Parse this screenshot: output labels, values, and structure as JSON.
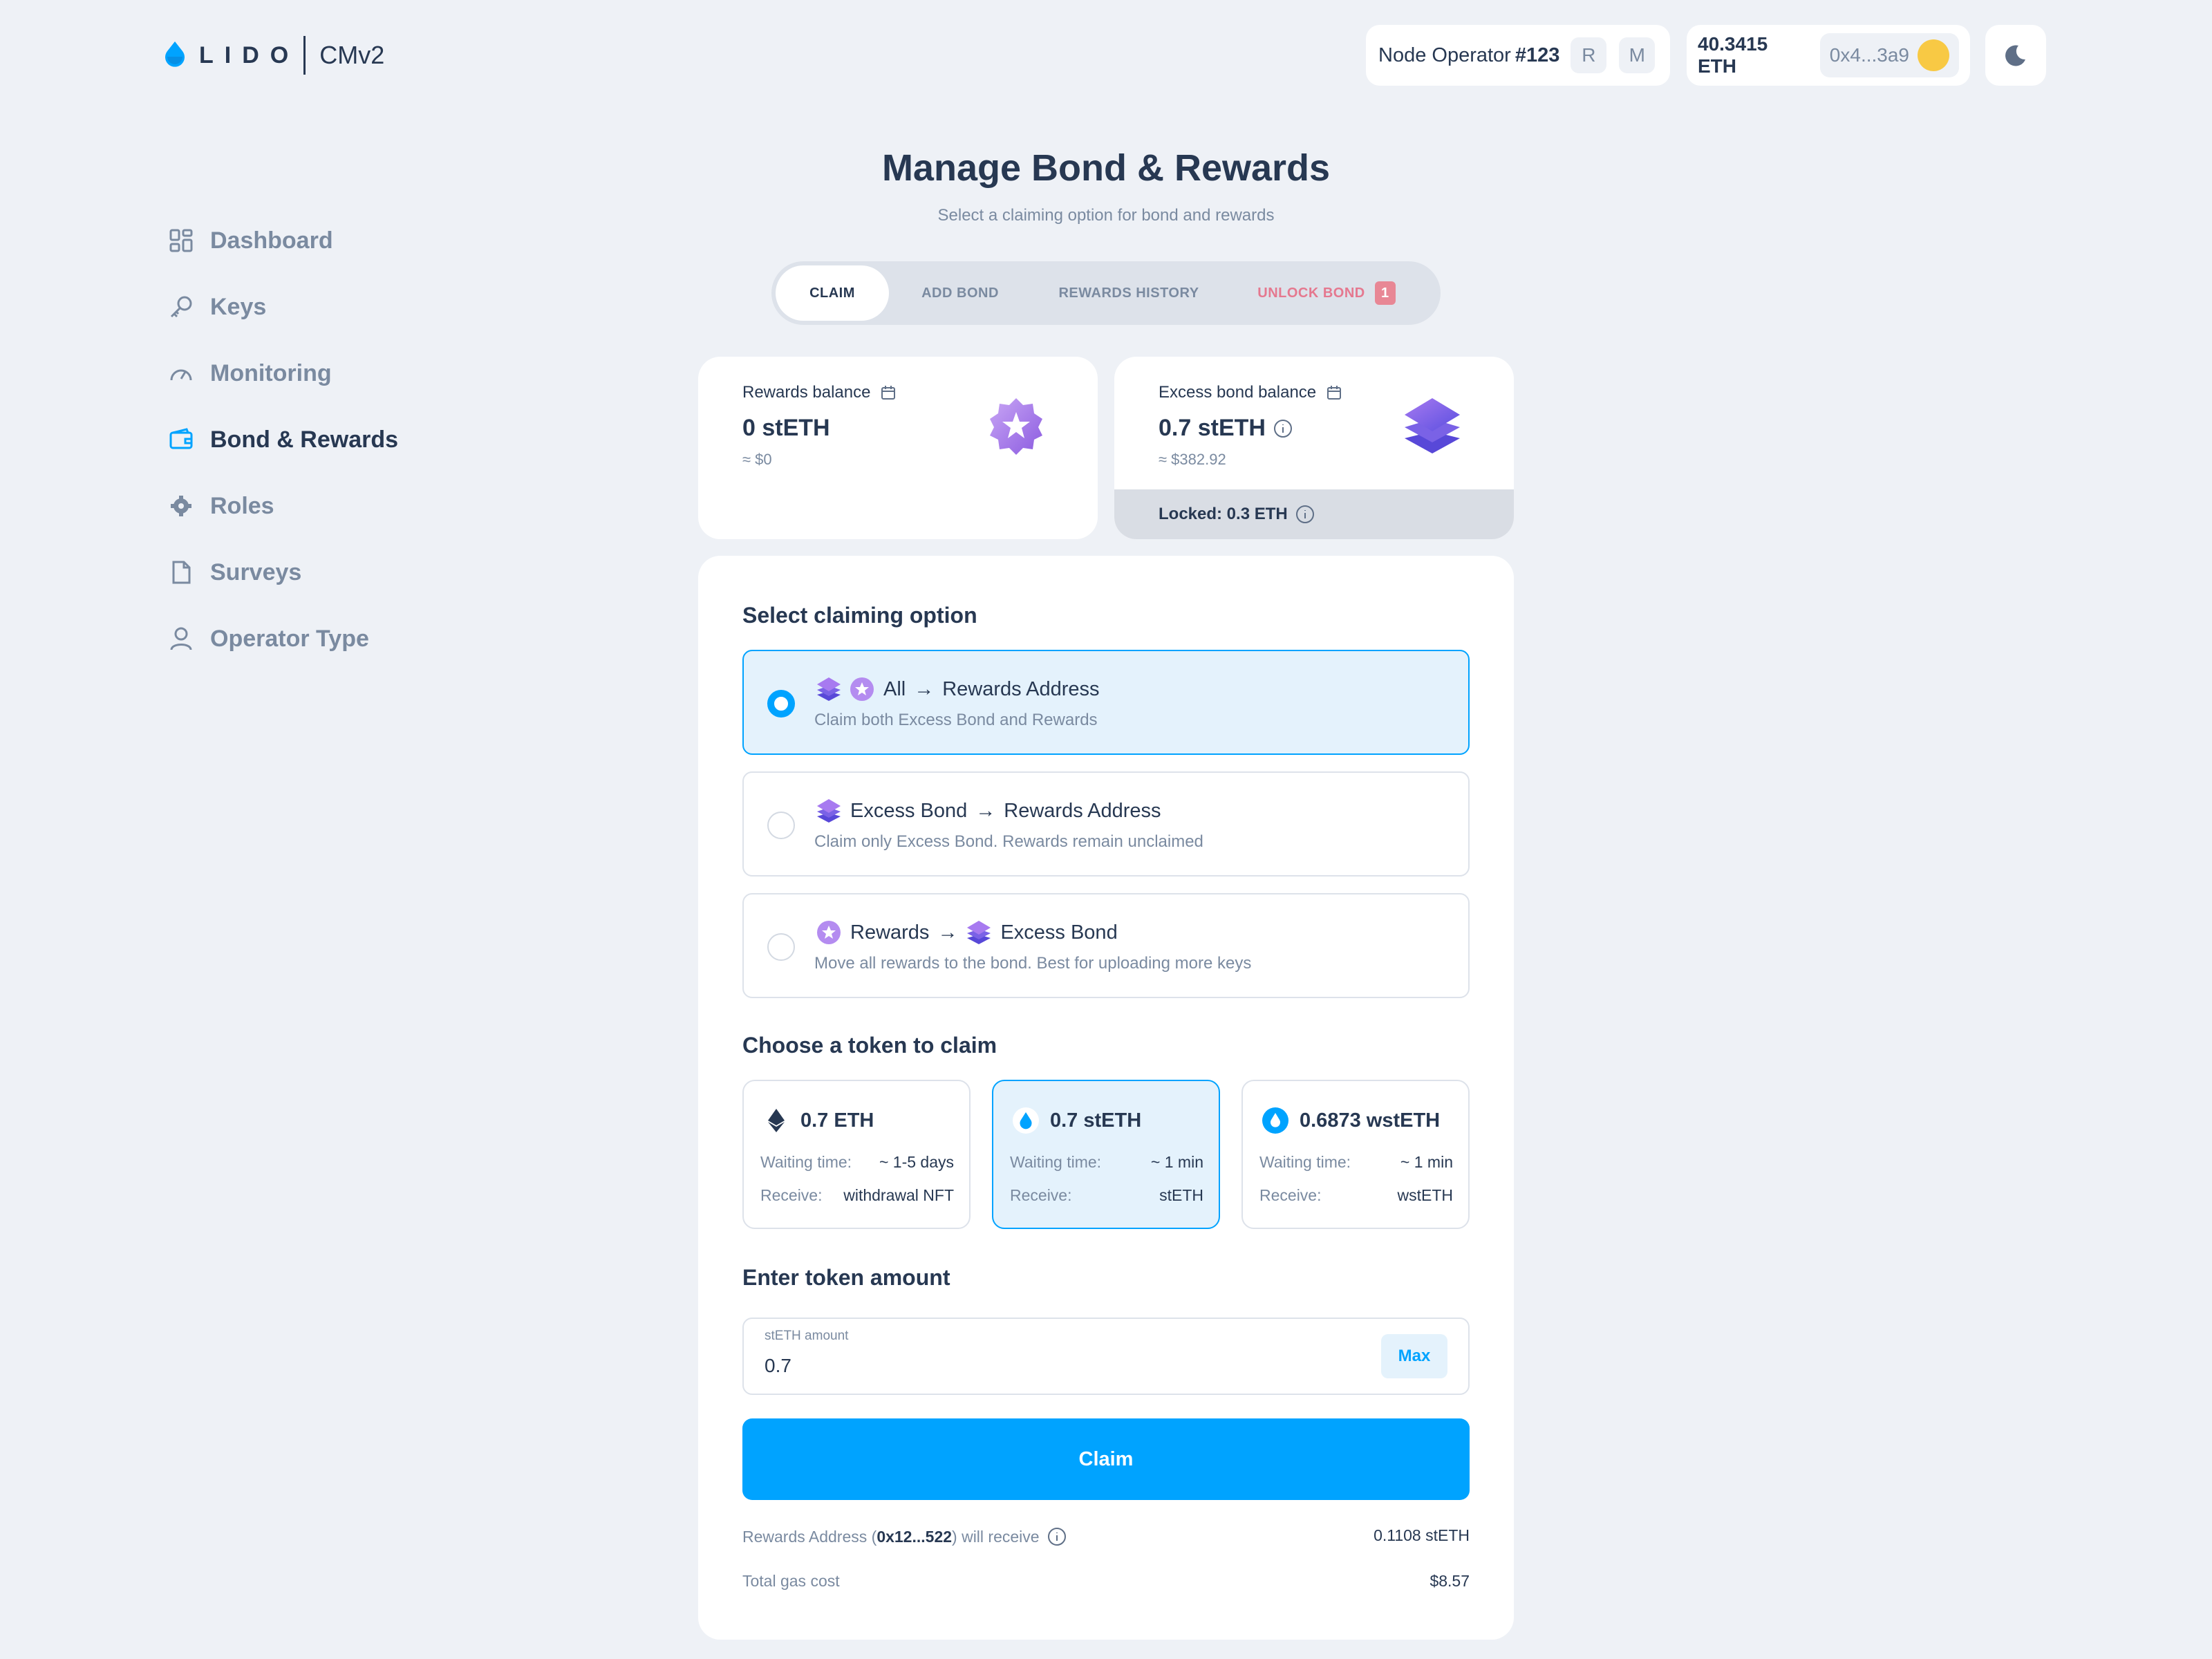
{
  "brand": {
    "name": "LIDO",
    "product": "CMv2"
  },
  "header": {
    "operator_label": "Node Operator",
    "operator_number": "#123",
    "role_badges": [
      "R",
      "M"
    ],
    "balance": "40.3415 ETH",
    "address": "0x4...3a9",
    "theme_icon": "moon-icon"
  },
  "sidebar": {
    "items": [
      {
        "label": "Dashboard",
        "icon": "grid-icon"
      },
      {
        "label": "Keys",
        "icon": "key-icon"
      },
      {
        "label": "Monitoring",
        "icon": "gauge-icon"
      },
      {
        "label": "Bond & Rewards",
        "icon": "wallet-icon",
        "active": true
      },
      {
        "label": "Roles",
        "icon": "gear-icon"
      },
      {
        "label": "Surveys",
        "icon": "document-icon"
      },
      {
        "label": "Operator Type",
        "icon": "user-icon"
      }
    ]
  },
  "page": {
    "title": "Manage Bond & Rewards",
    "subtitle": "Select a claiming option for bond and rewards"
  },
  "tabs": [
    {
      "label": "CLAIM",
      "active": true
    },
    {
      "label": "ADD BOND"
    },
    {
      "label": "REWARDS HISTORY"
    },
    {
      "label": "UNLOCK BOND",
      "badge": "1"
    }
  ],
  "balances": {
    "rewards": {
      "label": "Rewards balance",
      "value": "0 stETH",
      "usd": "≈ $0"
    },
    "excess": {
      "label": "Excess bond balance",
      "value": "0.7 stETH",
      "usd": "≈ $382.92",
      "locked": "Locked: 0.3 ETH"
    }
  },
  "claim": {
    "section_option": "Select claiming option",
    "options": [
      {
        "title_a": "All",
        "arrow": "→",
        "title_b": "Rewards Address",
        "desc": "Claim both Excess Bond and Rewards",
        "selected": true
      },
      {
        "title_a": "Excess Bond",
        "arrow": "→",
        "title_b": "Rewards Address",
        "desc": "Claim only Excess Bond. Rewards remain unclaimed"
      },
      {
        "title_a": "Rewards",
        "arrow": "→",
        "title_b": "Excess Bond",
        "desc": "Move all rewards to the bond. Best for uploading more keys"
      }
    ],
    "section_token": "Choose a token to claim",
    "tokens": [
      {
        "amount": "0.7 ETH",
        "wait_label": "Waiting time:",
        "wait": "~ 1-5 days",
        "recv_label": "Receive:",
        "recv": "withdrawal NFT"
      },
      {
        "amount": "0.7 stETH",
        "wait_label": "Waiting time:",
        "wait": "~ 1 min",
        "recv_label": "Receive:",
        "recv": "stETH",
        "selected": true
      },
      {
        "amount": "0.6873 wstETH",
        "wait_label": "Waiting time:",
        "wait": "~ 1 min",
        "recv_label": "Receive:",
        "recv": "wstETH"
      }
    ],
    "section_amount": "Enter token amount",
    "amount_label": "stETH amount",
    "amount_value": "0.7",
    "max_label": "Max",
    "button": "Claim",
    "summary": {
      "receive_prefix": "Rewards Address (",
      "receive_addr": "0x12...522",
      "receive_suffix": ") will receive",
      "receive_value": "0.1108 stETH",
      "gas_label": "Total gas cost",
      "gas_value": "$8.57"
    }
  },
  "colors": {
    "accent": "#00a3ff",
    "text": "#273852",
    "muted": "#7a8aa0",
    "warning": "#e5788f",
    "bg": "#eef1f6"
  }
}
